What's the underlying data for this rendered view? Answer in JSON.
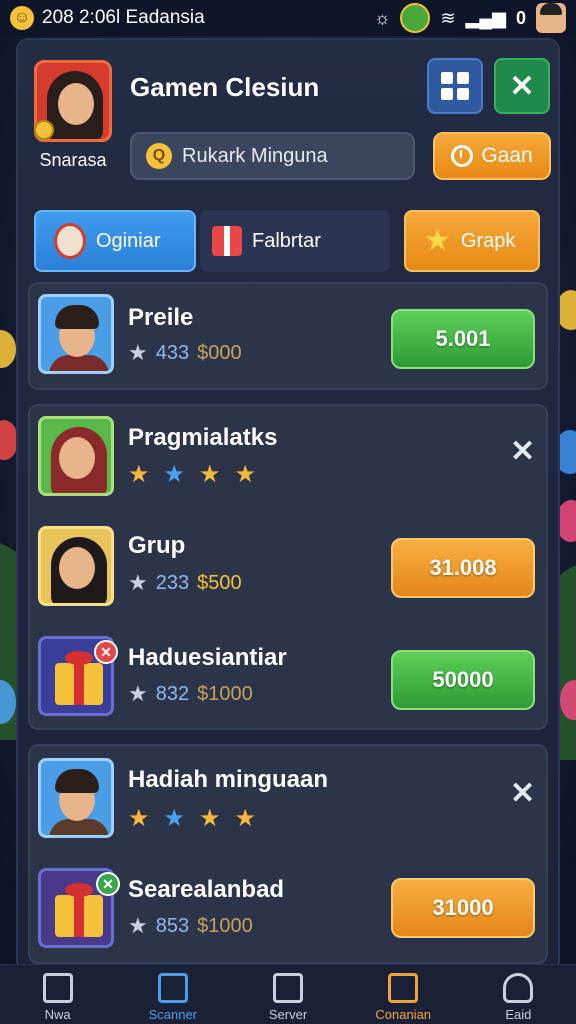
{
  "status_bar": {
    "time_text": "208 2:06l Eadansia",
    "battery_text": "0"
  },
  "header": {
    "title": "Gamen Clesiun",
    "profile_name": "Snarasa",
    "search": {
      "value": "Rukark Minguna",
      "icon": "search-icon"
    },
    "gain_label": "Gaan",
    "grid_icon": "grid-icon",
    "close_icon": "close-icon"
  },
  "tabs": [
    {
      "label": "Oginiar",
      "icon": "doll-icon",
      "active": true
    },
    {
      "label": "Falbrtar",
      "icon": "gift-icon",
      "active": false
    },
    {
      "label": "Grapk",
      "icon": "star-icon",
      "active": false
    }
  ],
  "rows": [
    {
      "name": "Preile",
      "level": "433",
      "coins": "$000",
      "value": "5.001",
      "button_color": "green"
    },
    {
      "name": "Pragmialatks",
      "stars": [
        "gold",
        "blue",
        "gold",
        "gold"
      ]
    },
    {
      "name": "Grup",
      "level": "233",
      "coins": "$500",
      "value": "31.008",
      "button_color": "orange"
    },
    {
      "name": "Haduesiantiar",
      "level": "832",
      "coins": "$1000",
      "value": "50000",
      "button_color": "green"
    },
    {
      "name": "Hadiah minguaan",
      "stars": [
        "gold",
        "blue",
        "gold",
        "gold"
      ]
    },
    {
      "name": "Searealanbad",
      "level": "853",
      "coins": "$1000",
      "value": "31000",
      "button_color": "orange"
    }
  ],
  "bottom_nav": [
    {
      "label": "Nwa",
      "icon": "grid-icon",
      "color": "#c8cfe0"
    },
    {
      "label": "Scanner",
      "icon": "scanner-icon",
      "color": "#4a9ee8"
    },
    {
      "label": "Server",
      "icon": "upload-icon",
      "color": "#c8cfe0"
    },
    {
      "label": "Conanian",
      "icon": "task-icon",
      "color": "#f3a23a"
    },
    {
      "label": "Eaid",
      "icon": "profile-icon",
      "color": "#c8cfe0"
    }
  ],
  "colors": {
    "accent_orange": "#f3a23a",
    "accent_green": "#3aa84a",
    "accent_blue": "#3e9cf0",
    "panel_bg": "#232c45"
  }
}
